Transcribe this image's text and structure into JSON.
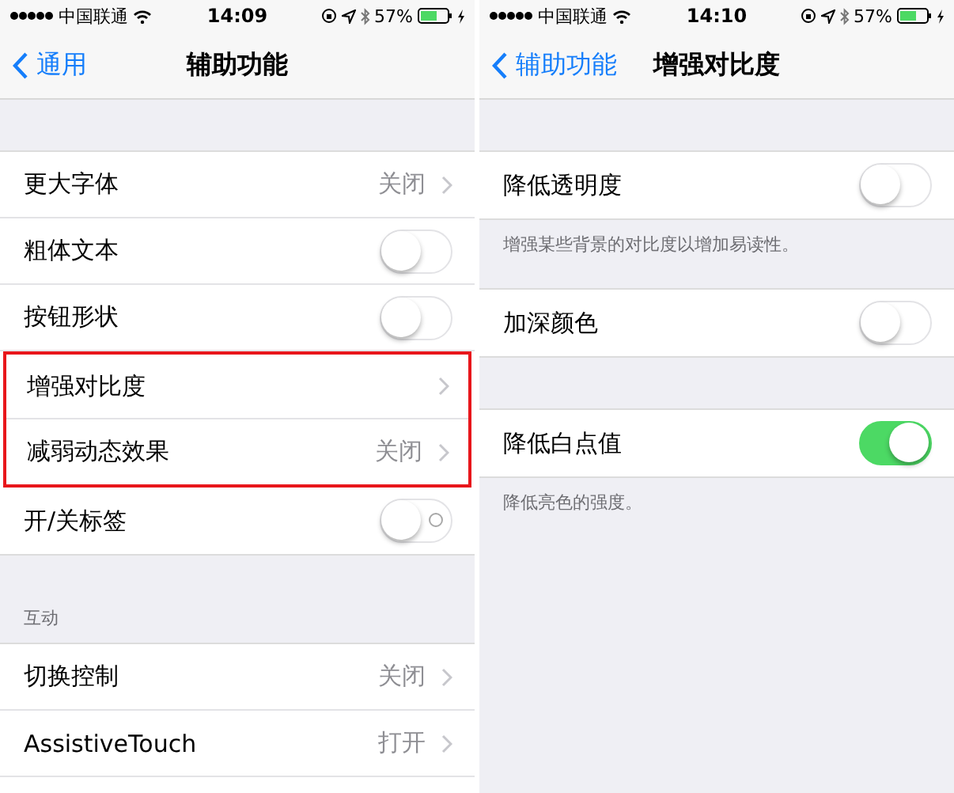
{
  "screens": [
    {
      "status_bar": {
        "carrier": "中国联通",
        "time": "14:09",
        "battery": "57%"
      },
      "nav": {
        "back": "通用",
        "title": "辅助功能"
      },
      "sections": [
        {
          "rows": [
            {
              "kind": "value",
              "label": "更大字体",
              "value": "关闭",
              "highlighted": false
            },
            {
              "kind": "toggle",
              "label": "粗体文本",
              "on": false,
              "highlighted": false
            },
            {
              "kind": "toggle",
              "label": "按钮形状",
              "on": false,
              "highlighted": false
            },
            {
              "kind": "value",
              "label": "增强对比度",
              "highlighted": true
            },
            {
              "kind": "value",
              "label": "减弱动态效果",
              "value": "关闭",
              "highlighted": true
            },
            {
              "kind": "toggle",
              "label": "开/关标签",
              "on": false,
              "labels": true,
              "highlighted": false
            }
          ]
        },
        {
          "header": "互动",
          "rows": [
            {
              "kind": "value",
              "label": "切换控制",
              "value": "关闭",
              "highlighted": false
            },
            {
              "kind": "value",
              "label": "AssistiveTouch",
              "value": "打开",
              "highlighted": false
            },
            {
              "kind": "partial",
              "highlighted": false
            }
          ]
        }
      ]
    },
    {
      "status_bar": {
        "carrier": "中国联通",
        "time": "14:10",
        "battery": "57%"
      },
      "nav": {
        "back": "辅助功能",
        "title": "增强对比度"
      },
      "sections": [
        {
          "rows": [
            {
              "kind": "toggle",
              "label": "降低透明度",
              "on": false,
              "highlighted": false
            }
          ],
          "footer": "增强某些背景的对比度以增加易读性。"
        },
        {
          "rows": [
            {
              "kind": "toggle",
              "label": "加深颜色",
              "on": false,
              "highlighted": false
            }
          ]
        },
        {
          "rows": [
            {
              "kind": "toggle",
              "label": "降低白点值",
              "on": true,
              "highlighted": false
            }
          ],
          "footer": "降低亮色的强度。"
        }
      ]
    }
  ]
}
